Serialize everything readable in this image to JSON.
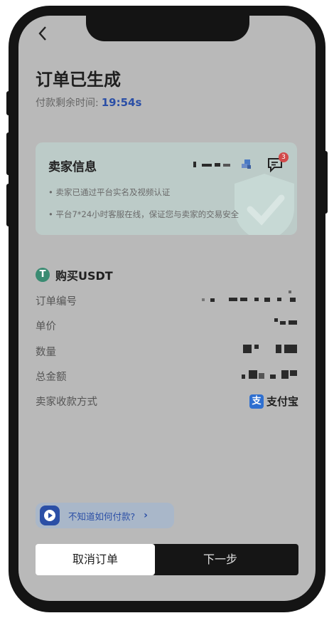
{
  "header": {
    "title": "订单已生成",
    "timer_label": "付款剩余时间:",
    "timer_value": "19:54s"
  },
  "seller_card": {
    "title": "卖家信息",
    "notes": [
      "• 卖家已通过平台实名及视频认证",
      "• 平台7*24小时客服在线，保证您与卖家的交易安全"
    ],
    "message_badge": "3"
  },
  "order": {
    "heading": "购买USDT",
    "coin_icon": "T",
    "fields": [
      {
        "label": "订单编号"
      },
      {
        "label": "单价"
      },
      {
        "label": "数量"
      },
      {
        "label": "总金额"
      },
      {
        "label": "卖家收款方式",
        "value": "支付宝"
      }
    ],
    "alipay_icon": "支"
  },
  "help": {
    "text": "不知道如何付款?",
    "chevron": "›"
  },
  "actions": {
    "cancel": "取消订单",
    "next": "下一步"
  },
  "colors": {
    "accent": "#2b4fa6",
    "background": "#b9b9b9",
    "primary_button": "#151515"
  }
}
